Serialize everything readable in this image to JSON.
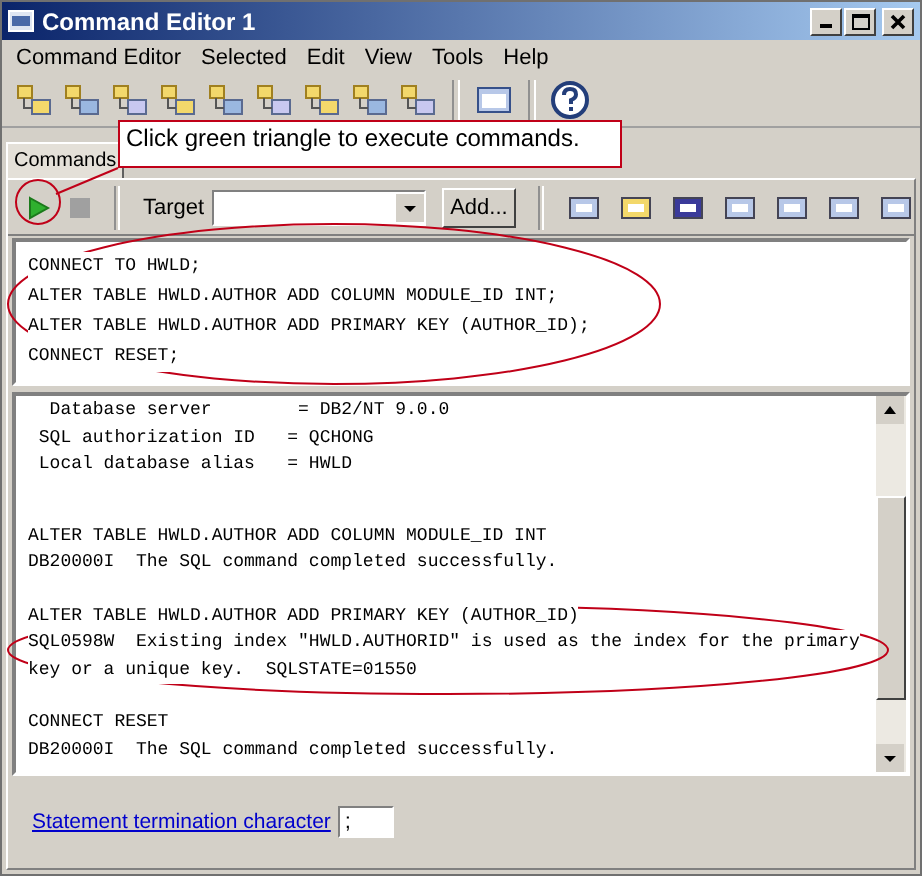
{
  "window": {
    "title": "Command Editor 1"
  },
  "menu": [
    "Command Editor",
    "Selected",
    "Edit",
    "View",
    "Tools",
    "Help"
  ],
  "tabs": [
    {
      "label": "Commands",
      "selected": true
    }
  ],
  "callout": {
    "text": "Click green triangle to execute commands."
  },
  "command_toolbar": {
    "target_label": "Target",
    "add_button": "Add..."
  },
  "editor": {
    "lines": [
      "CONNECT TO HWLD;",
      "ALTER TABLE HWLD.AUTHOR ADD COLUMN MODULE_ID INT;",
      "ALTER TABLE HWLD.AUTHOR ADD PRIMARY KEY (AUTHOR_ID);",
      "CONNECT RESET;"
    ]
  },
  "output": {
    "blocks": [
      [
        "  Database server        = DB2/NT 9.0.0",
        " SQL authorization ID   = QCHONG",
        " Local database alias   = HWLD"
      ],
      [
        "ALTER TABLE HWLD.AUTHOR ADD COLUMN MODULE_ID INT",
        "DB20000I  The SQL command completed successfully."
      ],
      [
        "ALTER TABLE HWLD.AUTHOR ADD PRIMARY KEY (AUTHOR_ID)",
        "SQL0598W  Existing index \"HWLD.AUTHORID\" is used as the index for the primary",
        "key or a unique key.  SQLSTATE=01550"
      ],
      [
        "CONNECT RESET",
        "DB20000I  The SQL command completed successfully."
      ]
    ]
  },
  "footer": {
    "link": "Statement termination character",
    "terminator_value": ";"
  }
}
